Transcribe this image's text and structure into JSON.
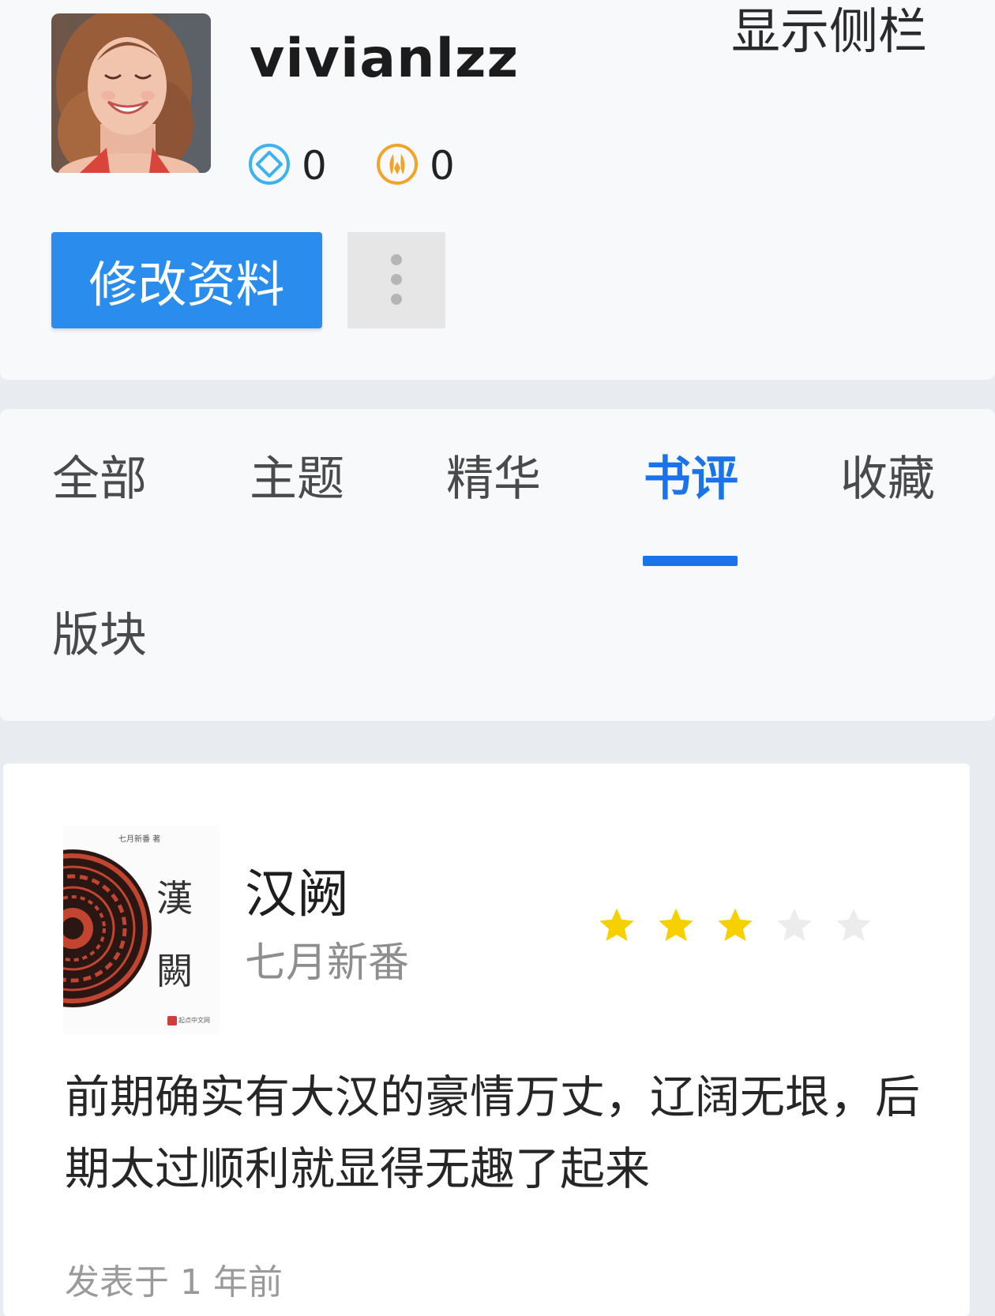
{
  "profile": {
    "username": "vivianlzz",
    "sidebar_toggle_label": "显示侧栏",
    "stats": [
      {
        "icon": "diamond-icon",
        "value": "0",
        "color": "#3db2ef"
      },
      {
        "icon": "coin-icon",
        "value": "0",
        "color": "#f0a429"
      }
    ],
    "edit_button_label": "修改资料",
    "more_button_icon": "vertical-ellipsis-icon"
  },
  "tabs": {
    "items": [
      {
        "label": "全部",
        "active": false
      },
      {
        "label": "主题",
        "active": false
      },
      {
        "label": "精华",
        "active": false
      },
      {
        "label": "书评",
        "active": true
      },
      {
        "label": "收藏",
        "active": false
      },
      {
        "label": "版块",
        "active": false
      }
    ],
    "accent_color": "#1a73e8"
  },
  "review": {
    "book_cover": {
      "title_glyphs": "漢\n闕",
      "top_text": "七月新番 著",
      "publisher": "起点中文网"
    },
    "book_title": "汉阙",
    "book_author": "七月新番",
    "rating": {
      "value": 3,
      "max": 5,
      "filled_color": "#f7d000",
      "empty_color": "#ececec"
    },
    "text": "前期确实有大汉的豪情万丈，辽阔无垠，后期太过顺利就显得无趣了起来",
    "posted_time": "发表于 1 年前"
  }
}
